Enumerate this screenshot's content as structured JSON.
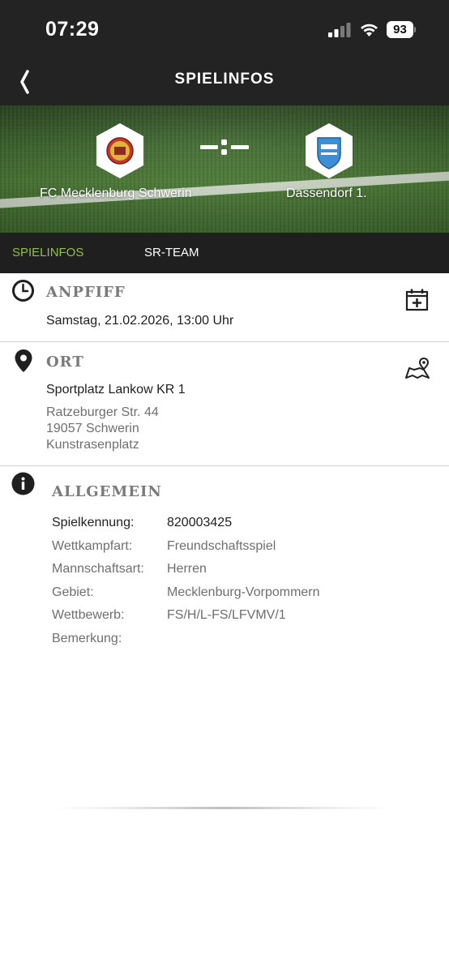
{
  "status_bar": {
    "time": "07:29",
    "battery": "93",
    "icons": [
      "signal-icon",
      "wifi-icon",
      "battery-icon"
    ]
  },
  "nav": {
    "title": "SPIELINFOS",
    "back_icon": "chevron-left-icon"
  },
  "match": {
    "home_team": "FC Mecklenburg Schwerin",
    "away_team": "Dassendorf 1.",
    "score_display": "-:-",
    "home_logo_icon": "club-crest-icon",
    "away_logo_icon": "club-crest-icon"
  },
  "tabs": [
    {
      "label": "SPIELINFOS",
      "active": true
    },
    {
      "label": "SR-TEAM",
      "active": false
    }
  ],
  "anpfiff": {
    "title": "ANPFIFF",
    "datetime": "Samstag, 21.02.2026, 13:00 Uhr",
    "icon": "clock-icon",
    "action_icon": "calendar-add-icon"
  },
  "ort": {
    "title": "ORT",
    "venue": "Sportplatz Lankow KR 1",
    "street": "Ratzeburger Str. 44",
    "city": "19057 Schwerin",
    "surface": "Kunstrasenplatz",
    "icon": "location-pin-icon",
    "action_icon": "map-icon"
  },
  "allgemein": {
    "title": "ALLGEMEIN",
    "icon": "info-icon",
    "rows": [
      {
        "label": "Spielkennung:",
        "value": "820003425"
      },
      {
        "label": "Wettkampfart:",
        "value": "Freundschaftsspiel"
      },
      {
        "label": "Mannschaftsart:",
        "value": "Herren"
      },
      {
        "label": "Gebiet:",
        "value": "Mecklenburg-Vorpommern"
      },
      {
        "label": "Wettbewerb:",
        "value": "FS/H/L-FS/LFVMV/1"
      },
      {
        "label": "Bemerkung:",
        "value": ""
      }
    ]
  },
  "colors": {
    "header_bg": "#232323",
    "tab_active": "#8fc24a",
    "tab_bar_bg": "#1f1f1f"
  }
}
